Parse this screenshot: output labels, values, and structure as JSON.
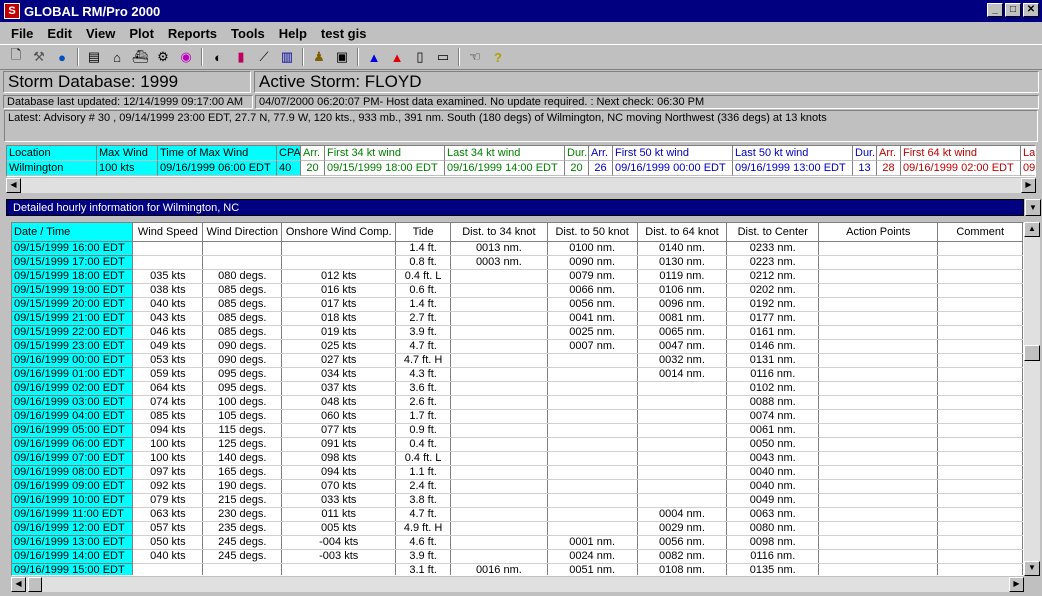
{
  "window": {
    "title": "GLOBAL RM/Pro 2000"
  },
  "menu": [
    "File",
    "Edit",
    "View",
    "Plot",
    "Reports",
    "Tools",
    "Help",
    "test gis"
  ],
  "status": {
    "storm_database": "Storm Database: 1999",
    "active_storm": "Active Storm: FLOYD",
    "db_updated": "Database last updated: 12/14/1999 09:17:00 AM",
    "host_check": "04/07/2000 06:20:07 PM- Host data examined.  No update required. :  Next check: 06:30 PM",
    "advisory": "Latest: Advisory # 30 , 09/14/1999 23:00 EDT, 27.7 N,  77.9 W, 120 kts.,  933 mb.,  391 nm. South (180 degs) of Wilmington, NC moving Northwest (336 degs) at 13 knots"
  },
  "location_table": {
    "headers": [
      "Location",
      "Max Wind",
      "Time of Max Wind",
      "CPA",
      "Arr.",
      "First 34 kt wind",
      "Last 34 kt wind",
      "Dur.",
      "Arr.",
      "First 50 kt wind",
      "Last 50 kt wind",
      "Dur.",
      "Arr.",
      "First 64 kt wind",
      "La"
    ],
    "row": [
      "Wilmington",
      "100 kts",
      "09/16/1999 06:00 EDT",
      "40",
      "20",
      "09/15/1999 18:00 EDT",
      "09/16/1999 14:00 EDT",
      "20",
      "26",
      "09/16/1999 00:00 EDT",
      "09/16/1999 13:00 EDT",
      "13",
      "28",
      "09/16/1999 02:00 EDT",
      "09"
    ]
  },
  "detail_title": "Detailed hourly information for Wilmington, NC",
  "hourly_table": {
    "headers": [
      "Date / Time",
      "Wind Speed",
      "Wind Direction",
      "Onshore Wind Comp.",
      "Tide",
      "Dist. to 34 knot",
      "Dist. to 50 knot",
      "Dist. to 64 knot",
      "Dist. to Center",
      "Action Points",
      "Comment"
    ],
    "rows": [
      [
        "09/15/1999 16:00 EDT",
        "",
        "",
        "",
        "1.4 ft.",
        "0013 nm.",
        "0100 nm.",
        "0140 nm.",
        "0233 nm.",
        "",
        ""
      ],
      [
        "09/15/1999 17:00 EDT",
        "",
        "",
        "",
        "0.8 ft.",
        "0003 nm.",
        "0090 nm.",
        "0130 nm.",
        "0223 nm.",
        "",
        ""
      ],
      [
        "09/15/1999 18:00 EDT",
        "035 kts",
        "080 degs.",
        "012 kts",
        "0.4 ft. L",
        "",
        "0079 nm.",
        "0119 nm.",
        "0212 nm.",
        "",
        ""
      ],
      [
        "09/15/1999 19:00 EDT",
        "038 kts",
        "085 degs.",
        "016 kts",
        "0.6 ft.",
        "",
        "0066 nm.",
        "0106 nm.",
        "0202 nm.",
        "",
        ""
      ],
      [
        "09/15/1999 20:00 EDT",
        "040 kts",
        "085 degs.",
        "017 kts",
        "1.4 ft.",
        "",
        "0056 nm.",
        "0096 nm.",
        "0192 nm.",
        "",
        ""
      ],
      [
        "09/15/1999 21:00 EDT",
        "043 kts",
        "085 degs.",
        "018 kts",
        "2.7 ft.",
        "",
        "0041 nm.",
        "0081 nm.",
        "0177 nm.",
        "",
        ""
      ],
      [
        "09/15/1999 22:00 EDT",
        "046 kts",
        "085 degs.",
        "019 kts",
        "3.9 ft.",
        "",
        "0025 nm.",
        "0065 nm.",
        "0161 nm.",
        "",
        ""
      ],
      [
        "09/15/1999 23:00 EDT",
        "049 kts",
        "090 degs.",
        "025 kts",
        "4.7 ft.",
        "",
        "0007 nm.",
        "0047 nm.",
        "0146 nm.",
        "",
        ""
      ],
      [
        "09/16/1999 00:00 EDT",
        "053 kts",
        "090 degs.",
        "027 kts",
        "4.7 ft. H",
        "",
        "",
        "0032 nm.",
        "0131 nm.",
        "",
        ""
      ],
      [
        "09/16/1999 01:00 EDT",
        "059 kts",
        "095 degs.",
        "034 kts",
        "4.3 ft.",
        "",
        "",
        "0014 nm.",
        "0116 nm.",
        "",
        ""
      ],
      [
        "09/16/1999 02:00 EDT",
        "064 kts",
        "095 degs.",
        "037 kts",
        "3.6 ft.",
        "",
        "",
        "",
        "0102 nm.",
        "",
        ""
      ],
      [
        "09/16/1999 03:00 EDT",
        "074 kts",
        "100 degs.",
        "048 kts",
        "2.6 ft.",
        "",
        "",
        "",
        "0088 nm.",
        "",
        ""
      ],
      [
        "09/16/1999 04:00 EDT",
        "085 kts",
        "105 degs.",
        "060 kts",
        "1.7 ft.",
        "",
        "",
        "",
        "0074 nm.",
        "",
        ""
      ],
      [
        "09/16/1999 05:00 EDT",
        "094 kts",
        "115 degs.",
        "077 kts",
        "0.9 ft.",
        "",
        "",
        "",
        "0061 nm.",
        "",
        ""
      ],
      [
        "09/16/1999 06:00 EDT",
        "100 kts",
        "125 degs.",
        "091 kts",
        "0.4 ft.",
        "",
        "",
        "",
        "0050 nm.",
        "",
        ""
      ],
      [
        "09/16/1999 07:00 EDT",
        "100 kts",
        "140 degs.",
        "098 kts",
        "0.4 ft. L",
        "",
        "",
        "",
        "0043 nm.",
        "",
        ""
      ],
      [
        "09/16/1999 08:00 EDT",
        "097 kts",
        "165 degs.",
        "094 kts",
        "1.1 ft.",
        "",
        "",
        "",
        "0040 nm.",
        "",
        ""
      ],
      [
        "09/16/1999 09:00 EDT",
        "092 kts",
        "190 degs.",
        "070 kts",
        "2.4 ft.",
        "",
        "",
        "",
        "0040 nm.",
        "",
        ""
      ],
      [
        "09/16/1999 10:00 EDT",
        "079 kts",
        "215 degs.",
        "033 kts",
        "3.8 ft.",
        "",
        "",
        "",
        "0049 nm.",
        "",
        ""
      ],
      [
        "09/16/1999 11:00 EDT",
        "063 kts",
        "230 degs.",
        "011 kts",
        "4.7 ft.",
        "",
        "",
        "0004 nm.",
        "0063 nm.",
        "",
        ""
      ],
      [
        "09/16/1999 12:00 EDT",
        "057 kts",
        "235 degs.",
        "005 kts",
        "4.9 ft. H",
        "",
        "",
        "0029 nm.",
        "0080 nm.",
        "",
        ""
      ],
      [
        "09/16/1999 13:00 EDT",
        "050 kts",
        "245 degs.",
        "-004 kts",
        "4.6 ft.",
        "",
        "0001 nm.",
        "0056 nm.",
        "0098 nm.",
        "",
        ""
      ],
      [
        "09/16/1999 14:00 EDT",
        "040 kts",
        "245 degs.",
        "-003 kts",
        "3.9 ft.",
        "",
        "0024 nm.",
        "0082 nm.",
        "0116 nm.",
        "",
        ""
      ],
      [
        "09/16/1999 15:00 EDT",
        "",
        "",
        "",
        "3.1 ft.",
        "0016 nm.",
        "0051 nm.",
        "0108 nm.",
        "0135 nm.",
        "",
        ""
      ]
    ]
  },
  "toolbar_icons": [
    "new-file-icon",
    "tools-icon",
    "globe-icon",
    "building-icon",
    "house-icon",
    "ship-icon",
    "factory-icon",
    "target-icon",
    "eye-icon",
    "book-icon",
    "chart-line-icon",
    "bar-chart-icon",
    "person-icon",
    "monitor-icon",
    "triangle-blue-icon",
    "triangle-red-icon",
    "clipboard-icon",
    "document-icon",
    "hand-icon",
    "help-icon"
  ]
}
